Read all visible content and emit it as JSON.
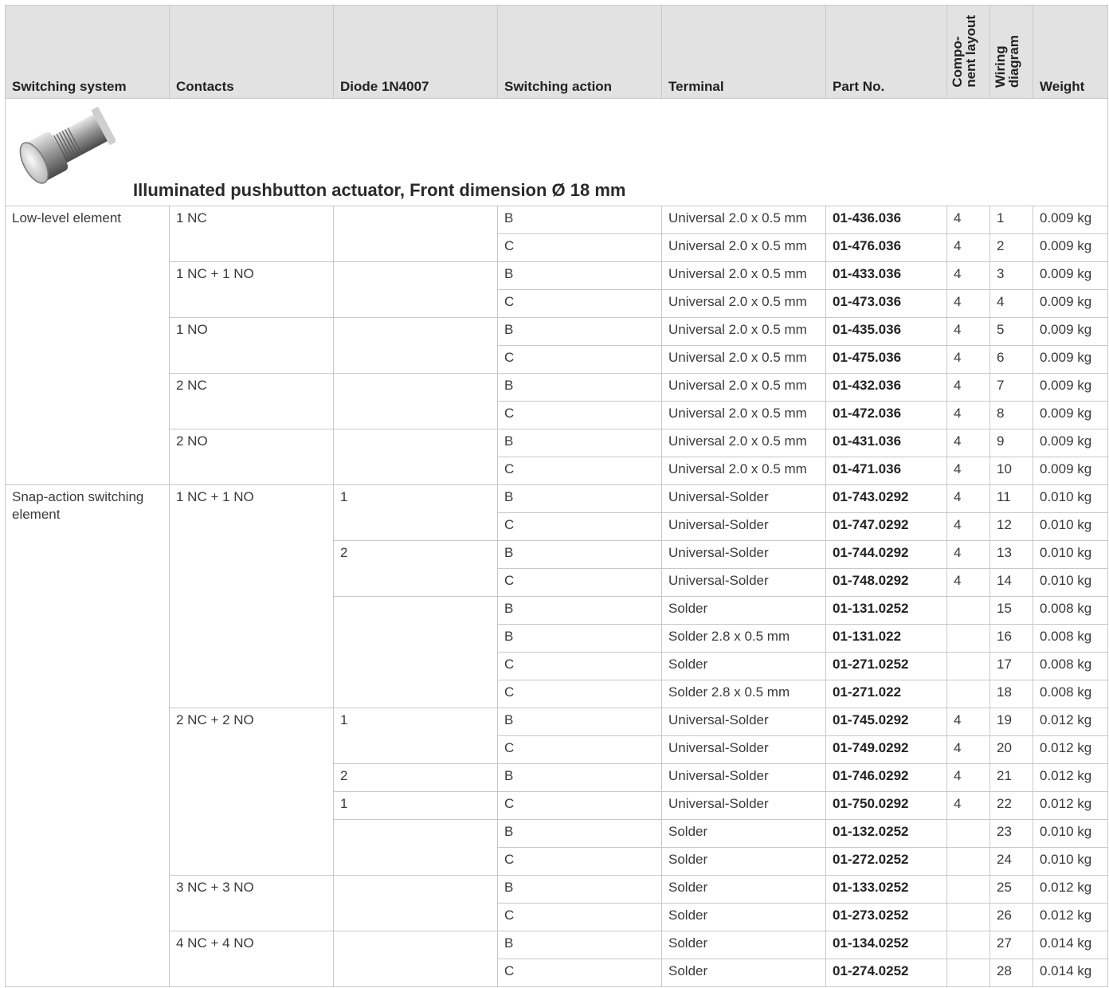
{
  "headers": {
    "switching_system": "Switching system",
    "contacts": "Contacts",
    "diode": "Diode 1N4007",
    "switching_action": "Switching action",
    "terminal": "Terminal",
    "part_no": "Part No.",
    "component_layout": "Compo-\nnent layout",
    "wiring_diagram": "Wiring\ndiagram",
    "weight": "Weight"
  },
  "section": {
    "title": "Illuminated pushbutton actuator, Front dimension Ø 18 mm"
  },
  "groups": {
    "low_level": "Low-level element",
    "snap_action": "Snap-action switching element"
  },
  "contacts": {
    "c1": "1 NC",
    "c2": "1 NC + 1 NO",
    "c3": "1 NO",
    "c4": "2 NC",
    "c5": "2 NO",
    "c6": "1 NC + 1 NO",
    "c7": "2 NC + 2 NO",
    "c8": "3 NC + 3 NO",
    "c9": "4 NC + 4 NO"
  },
  "diodes": {
    "d1": "1",
    "d2": "2",
    "d3": "1",
    "d4": "2",
    "d5": "1"
  },
  "rows": [
    {
      "action": "B",
      "terminal": "Universal 2.0 x 0.5 mm",
      "part": "01-436.036",
      "layout": "4",
      "wiring": "1",
      "weight": "0.009 kg"
    },
    {
      "action": "C",
      "terminal": "Universal 2.0 x 0.5 mm",
      "part": "01-476.036",
      "layout": "4",
      "wiring": "2",
      "weight": "0.009 kg"
    },
    {
      "action": "B",
      "terminal": "Universal 2.0 x 0.5 mm",
      "part": "01-433.036",
      "layout": "4",
      "wiring": "3",
      "weight": "0.009 kg"
    },
    {
      "action": "C",
      "terminal": "Universal 2.0 x 0.5 mm",
      "part": "01-473.036",
      "layout": "4",
      "wiring": "4",
      "weight": "0.009 kg"
    },
    {
      "action": "B",
      "terminal": "Universal 2.0 x 0.5 mm",
      "part": "01-435.036",
      "layout": "4",
      "wiring": "5",
      "weight": "0.009 kg"
    },
    {
      "action": "C",
      "terminal": "Universal 2.0 x 0.5 mm",
      "part": "01-475.036",
      "layout": "4",
      "wiring": "6",
      "weight": "0.009 kg"
    },
    {
      "action": "B",
      "terminal": "Universal 2.0 x 0.5 mm",
      "part": "01-432.036",
      "layout": "4",
      "wiring": "7",
      "weight": "0.009 kg"
    },
    {
      "action": "C",
      "terminal": "Universal 2.0 x 0.5 mm",
      "part": "01-472.036",
      "layout": "4",
      "wiring": "8",
      "weight": "0.009 kg"
    },
    {
      "action": "B",
      "terminal": "Universal 2.0 x 0.5 mm",
      "part": "01-431.036",
      "layout": "4",
      "wiring": "9",
      "weight": "0.009 kg"
    },
    {
      "action": "C",
      "terminal": "Universal 2.0 x 0.5 mm",
      "part": "01-471.036",
      "layout": "4",
      "wiring": "10",
      "weight": "0.009 kg"
    },
    {
      "action": "B",
      "terminal": "Universal-Solder",
      "part": "01-743.0292",
      "layout": "4",
      "wiring": "11",
      "weight": "0.010 kg"
    },
    {
      "action": "C",
      "terminal": "Universal-Solder",
      "part": "01-747.0292",
      "layout": "4",
      "wiring": "12",
      "weight": "0.010 kg"
    },
    {
      "action": "B",
      "terminal": "Universal-Solder",
      "part": "01-744.0292",
      "layout": "4",
      "wiring": "13",
      "weight": "0.010 kg"
    },
    {
      "action": "C",
      "terminal": "Universal-Solder",
      "part": "01-748.0292",
      "layout": "4",
      "wiring": "14",
      "weight": "0.010 kg"
    },
    {
      "action": "B",
      "terminal": "Solder",
      "part": "01-131.0252",
      "layout": "",
      "wiring": "15",
      "weight": "0.008 kg"
    },
    {
      "action": "B",
      "terminal": "Solder 2.8 x 0.5 mm",
      "part": "01-131.022",
      "layout": "",
      "wiring": "16",
      "weight": "0.008 kg"
    },
    {
      "action": "C",
      "terminal": "Solder",
      "part": "01-271.0252",
      "layout": "",
      "wiring": "17",
      "weight": "0.008 kg"
    },
    {
      "action": "C",
      "terminal": "Solder 2.8 x 0.5 mm",
      "part": "01-271.022",
      "layout": "",
      "wiring": "18",
      "weight": "0.008 kg"
    },
    {
      "action": "B",
      "terminal": "Universal-Solder",
      "part": "01-745.0292",
      "layout": "4",
      "wiring": "19",
      "weight": "0.012 kg"
    },
    {
      "action": "C",
      "terminal": "Universal-Solder",
      "part": "01-749.0292",
      "layout": "4",
      "wiring": "20",
      "weight": "0.012 kg"
    },
    {
      "action": "B",
      "terminal": "Universal-Solder",
      "part": "01-746.0292",
      "layout": "4",
      "wiring": "21",
      "weight": "0.012 kg"
    },
    {
      "action": "C",
      "terminal": "Universal-Solder",
      "part": "01-750.0292",
      "layout": "4",
      "wiring": "22",
      "weight": "0.012 kg"
    },
    {
      "action": "B",
      "terminal": "Solder",
      "part": "01-132.0252",
      "layout": "",
      "wiring": "23",
      "weight": "0.010 kg"
    },
    {
      "action": "C",
      "terminal": "Solder",
      "part": "01-272.0252",
      "layout": "",
      "wiring": "24",
      "weight": "0.010 kg"
    },
    {
      "action": "B",
      "terminal": "Solder",
      "part": "01-133.0252",
      "layout": "",
      "wiring": "25",
      "weight": "0.012 kg"
    },
    {
      "action": "C",
      "terminal": "Solder",
      "part": "01-273.0252",
      "layout": "",
      "wiring": "26",
      "weight": "0.012 kg"
    },
    {
      "action": "B",
      "terminal": "Solder",
      "part": "01-134.0252",
      "layout": "",
      "wiring": "27",
      "weight": "0.014 kg"
    },
    {
      "action": "C",
      "terminal": "Solder",
      "part": "01-274.0252",
      "layout": "",
      "wiring": "28",
      "weight": "0.014 kg"
    }
  ]
}
